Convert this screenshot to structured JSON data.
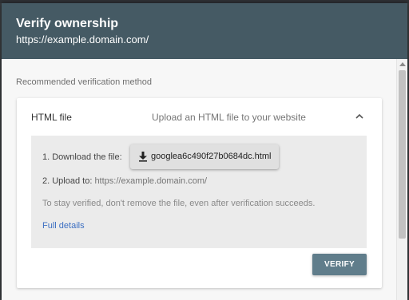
{
  "dialog": {
    "title": "Verify ownership",
    "property_url": "https://example.domain.com/"
  },
  "section_label": "Recommended verification method",
  "method": {
    "name": "HTML file",
    "description": "Upload an HTML file to your website",
    "expanded": true,
    "toggle_icon": "chevron-up-icon"
  },
  "steps": {
    "step1_label": "1. Download the file:",
    "download_filename": "googlea6c490f27b0684dc.html",
    "download_icon": "download-icon",
    "step2_prefix": "2. Upload to: ",
    "step2_url": "https://example.domain.com/",
    "note": "To stay verified, don't remove the file, even after verification succeeds.",
    "details_link": "Full details"
  },
  "actions": {
    "verify_label": "VERIFY"
  },
  "colors": {
    "header": "#455a64",
    "verify_button": "#607d8b",
    "link": "#3c6fc2",
    "panel": "#ebebeb"
  }
}
